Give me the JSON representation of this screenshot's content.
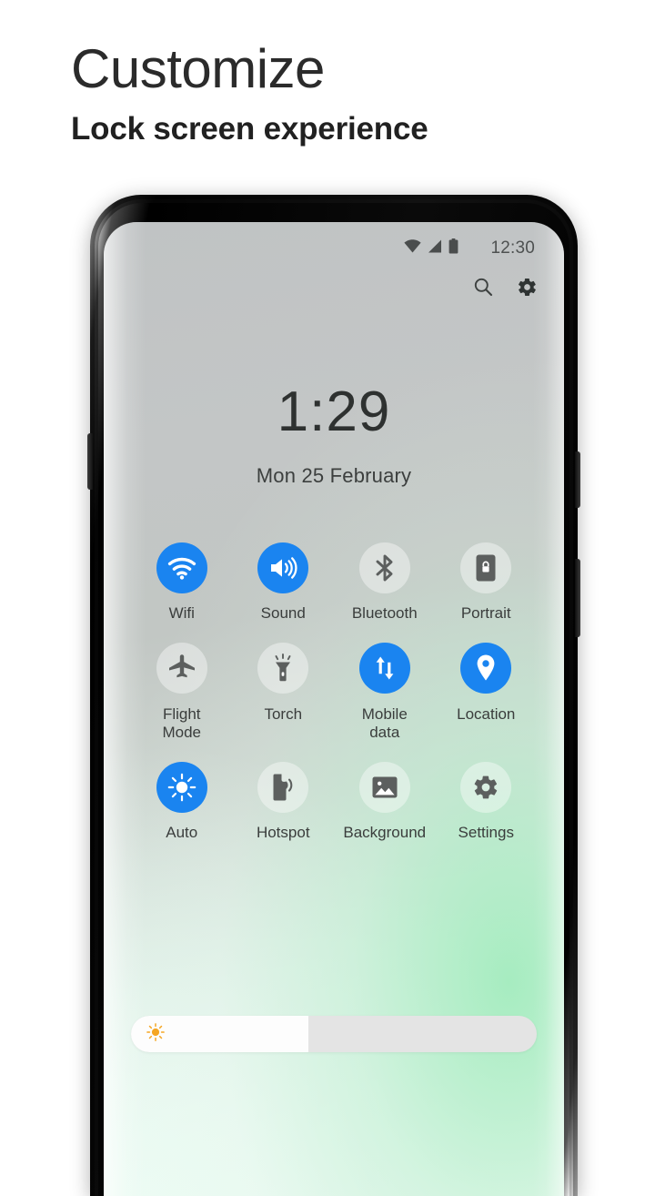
{
  "promo": {
    "title": "Customize",
    "subtitle": "Lock screen experience"
  },
  "colors": {
    "accent_on": "#1a84f0",
    "icon_off": "#5c5f5e",
    "text": "#3a3d3c",
    "sun": "#f5a623"
  },
  "phone": {
    "status_bar": {
      "time": "12:30",
      "icons": [
        "wifi-icon",
        "signal-icon",
        "battery-icon"
      ]
    },
    "top_actions": [
      {
        "name": "search-icon",
        "label": "Search"
      },
      {
        "name": "gear-icon",
        "label": "Settings"
      }
    ],
    "lock_screen": {
      "clock": "1:29",
      "date": "Mon 25 February"
    },
    "quick_settings": {
      "rows": [
        [
          {
            "label": "Wifi",
            "icon": "wifi-icon",
            "active": true
          },
          {
            "label": "Sound",
            "icon": "volume-icon",
            "active": true
          },
          {
            "label": "Bluetooth",
            "icon": "bluetooth-icon",
            "active": false
          },
          {
            "label": "Portrait",
            "icon": "rotation-lock-icon",
            "active": false
          }
        ],
        [
          {
            "label": "Flight\nMode",
            "icon": "airplane-icon",
            "active": false
          },
          {
            "label": "Torch",
            "icon": "flashlight-icon",
            "active": false
          },
          {
            "label": "Mobile\ndata",
            "icon": "mobile-data-icon",
            "active": true
          },
          {
            "label": "Location",
            "icon": "location-pin-icon",
            "active": true
          }
        ],
        [
          {
            "label": "Auto",
            "icon": "auto-brightness-icon",
            "active": true
          },
          {
            "label": "Hotspot",
            "icon": "hotspot-icon",
            "active": false
          },
          {
            "label": "Background",
            "icon": "image-icon",
            "active": false
          },
          {
            "label": "Settings",
            "icon": "gear-icon",
            "active": false
          }
        ]
      ]
    },
    "brightness_slider": {
      "icon": "sun-icon",
      "value_percent": 40
    }
  }
}
